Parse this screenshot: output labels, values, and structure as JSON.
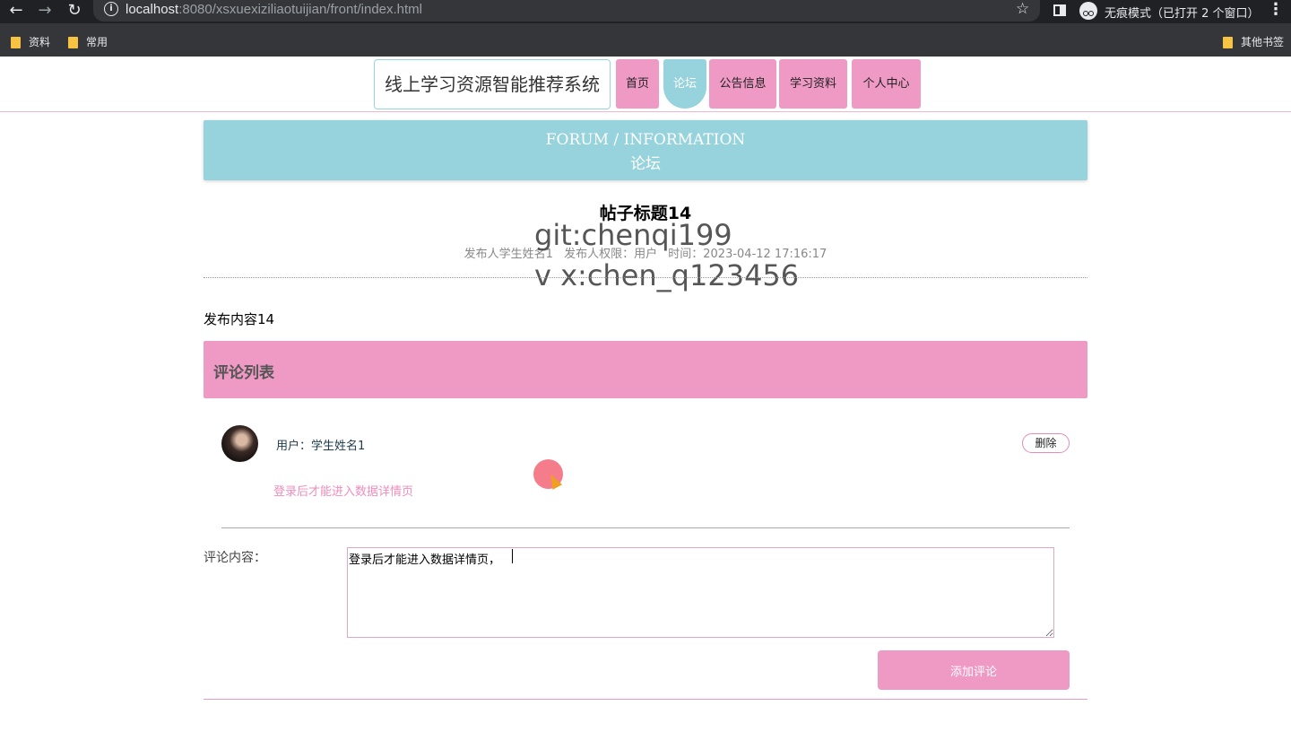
{
  "browser": {
    "url_host": "localhost",
    "url_rest": ":8080/xsxuexiziliaotuijian/front/index.html",
    "incognito_label": "无痕模式（已打开 2 个窗口）",
    "bookmarks": [
      "资料",
      "常用"
    ],
    "other_bookmarks": "其他书签",
    "icons": {
      "back": "arrow-left-icon",
      "forward": "arrow-right-icon",
      "reload": "reload-icon",
      "star": "star-icon",
      "menu": "kebab-menu-icon"
    }
  },
  "site": {
    "brand": "线上学习资源智能推荐系统",
    "nav": [
      {
        "label": "首页",
        "active": false
      },
      {
        "label": "论坛",
        "active": true
      },
      {
        "label": "公告信息",
        "active": false
      },
      {
        "label": "学习资料",
        "active": false
      },
      {
        "label": "个人中心",
        "active": false
      }
    ]
  },
  "banner": {
    "en": "FORUM / INFORMATION",
    "cn": "论坛"
  },
  "post": {
    "title": "帖子标题14",
    "author": "发布人学生姓名1",
    "permission": "发布人权限：用户",
    "time": "时间：2023-04-12 17:16:17",
    "content": "发布内容14"
  },
  "watermark": [
    "git:chenqi199",
    "v x:chen_q123456"
  ],
  "comments": {
    "header": "评论列表",
    "items": [
      {
        "user": "用户：学生姓名1",
        "text": "登录后才能进入数据详情页",
        "delete_label": "删除"
      }
    ]
  },
  "form": {
    "label": "评论内容：",
    "value": "登录后才能进入数据详情页，",
    "submit_label": "添加评论"
  },
  "colors": {
    "pink": "#ef99c5",
    "teal": "#97d3dc"
  }
}
